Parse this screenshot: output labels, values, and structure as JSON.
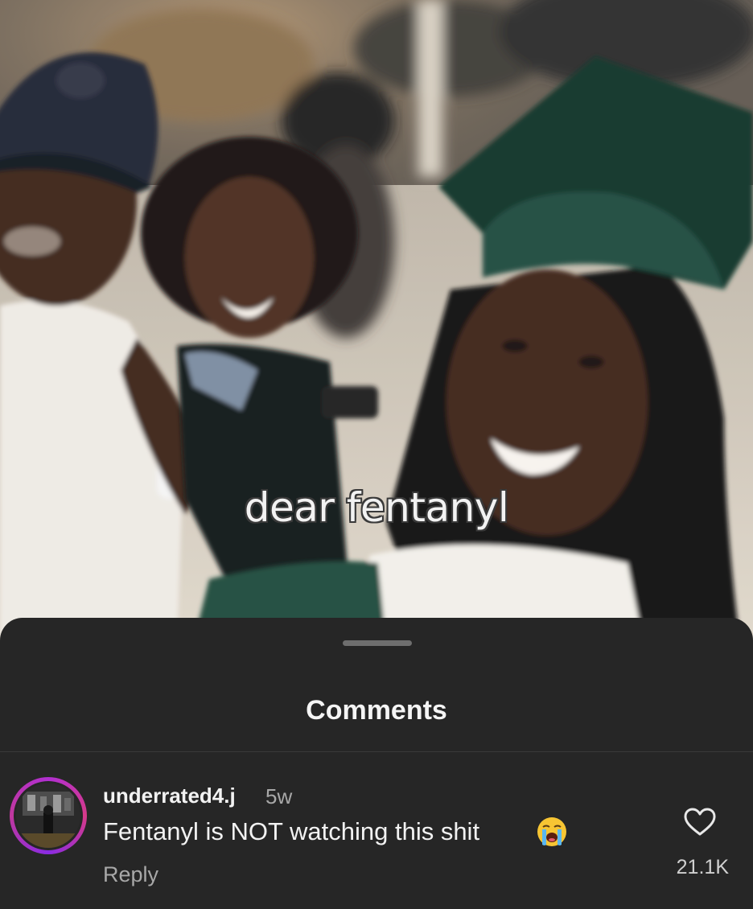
{
  "video": {
    "caption": "dear fentanyl"
  },
  "comments_sheet": {
    "title": "Comments",
    "comment": {
      "username": "underrated4.j",
      "time": "5w",
      "text": "Fentanyl is NOT watching this shit",
      "emoji": "loudly-crying-face-icon",
      "reply_label": "Reply",
      "like_count": "21.1K"
    }
  },
  "colors": {
    "sheet_background": "#262626",
    "avatar_ring": "#b12fd1",
    "secondary_text": "#a8a8a8",
    "primary_text": "#f2f2f2",
    "cap_green": "#1e4a3c"
  }
}
